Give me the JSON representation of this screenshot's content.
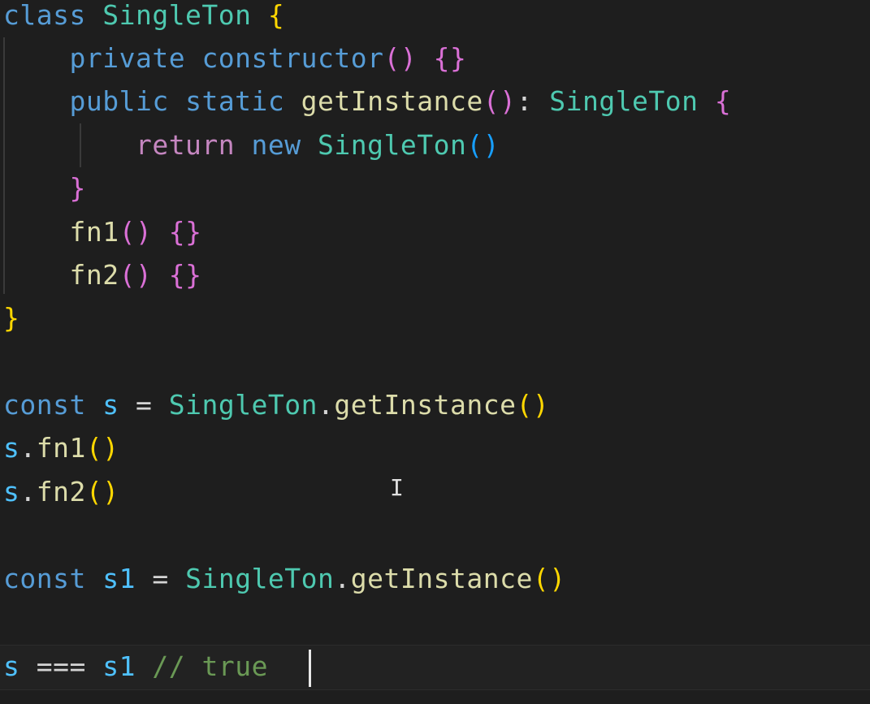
{
  "editor": {
    "language": "TypeScript",
    "theme": "dark",
    "colors": {
      "background": "#1e1e1e",
      "keyword": "#569cd6",
      "control_keyword": "#c586c0",
      "type": "#4ec9b0",
      "function": "#dcdcaa",
      "variable": "#4fc1ff",
      "bracket_level1": "#ffd700",
      "bracket_level2": "#da70d6",
      "bracket_level3": "#179fff",
      "comment": "#6a9955"
    },
    "code": {
      "l1": {
        "kw": "class",
        "name": "SingleTon",
        "open": "{"
      },
      "l2": {
        "kw": "private",
        "name": "constructor",
        "parens": "()",
        "body": "{}"
      },
      "l3": {
        "kw1": "public",
        "kw2": "static",
        "name": "getInstance",
        "parens": "()",
        "colon": ":",
        "type": "SingleTon",
        "open": "{"
      },
      "l4": {
        "kw1": "return",
        "kw2": "new",
        "name": "SingleTon",
        "parens": "()"
      },
      "l5": {
        "close": "}"
      },
      "l6": {
        "name": "fn1",
        "parens": "()",
        "body": "{}"
      },
      "l7": {
        "name": "fn2",
        "parens": "()",
        "body": "{}"
      },
      "l8": {
        "close": "}"
      },
      "l10": {
        "kw": "const",
        "var": "s",
        "eq": "=",
        "type": "SingleTon",
        "dot": ".",
        "method": "getInstance",
        "parens": "()"
      },
      "l11": {
        "var": "s",
        "dot": ".",
        "method": "fn1",
        "parens": "()"
      },
      "l12": {
        "var": "s",
        "dot": ".",
        "method": "fn2",
        "parens": "()"
      },
      "l14": {
        "kw": "const",
        "var": "s1",
        "eq": "=",
        "type": "SingleTon",
        "dot": ".",
        "method": "getInstance",
        "parens": "()"
      },
      "l16": {
        "var1": "s",
        "op": "===",
        "var2": "s1",
        "comment": "// true"
      }
    },
    "mouse_cursor": "I"
  }
}
